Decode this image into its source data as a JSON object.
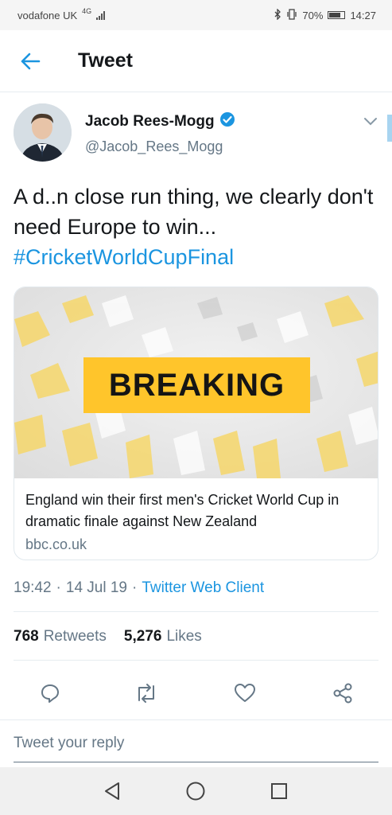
{
  "status_bar": {
    "carrier": "vodafone UK",
    "network": "4G",
    "battery": "70%",
    "time": "14:27",
    "icons": [
      "signal-icon",
      "bluetooth-icon",
      "vibrate-icon",
      "battery-icon"
    ]
  },
  "header": {
    "title": "Tweet",
    "back_icon": "back-arrow-icon"
  },
  "tweet": {
    "author_name": "Jacob Rees-Mogg",
    "author_handle": "@Jacob_Rees_Mogg",
    "verified": true,
    "text": "A d..n close run thing, we clearly don't need Europe to win...",
    "hashtag": "#CricketWorldCupFinal",
    "card": {
      "image_label": "BREAKING",
      "title": "England win their first men's Cricket World Cup in dramatic finale against New Zealand",
      "domain": "bbc.co.uk"
    },
    "time": "19:42",
    "date": "14 Jul 19",
    "client": "Twitter Web Client",
    "retweet_count": "768",
    "retweet_label": "Retweets",
    "like_count": "5,276",
    "like_label": "Likes"
  },
  "reply": {
    "placeholder": "Tweet your reply"
  },
  "colors": {
    "accent": "#1b95e0",
    "breaking_yellow": "#ffc52b",
    "muted": "#657786"
  }
}
